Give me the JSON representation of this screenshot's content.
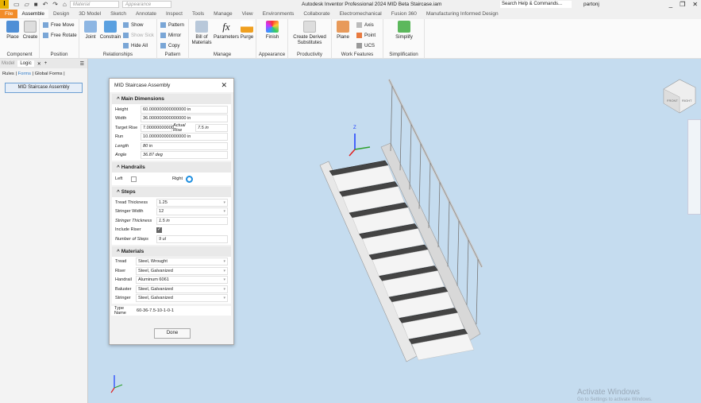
{
  "titlebar": {
    "app_title": "Autodesk Inventor Professional 2024   MID Beta Staircase.iam",
    "material_placeholder": "Material",
    "appearance_placeholder": "Appearance",
    "search_placeholder": "Search Help & Commands...",
    "user": "partonj"
  },
  "tabs": [
    "File",
    "Assemble",
    "Design",
    "3D Model",
    "Sketch",
    "Annotate",
    "Inspect",
    "Tools",
    "Manage",
    "View",
    "Environments",
    "Collaborate",
    "Electromechanical",
    "Fusion 360",
    "Manufacturing Informed Design"
  ],
  "active_tab": "Assemble",
  "ribbon": {
    "component": {
      "label": "Component",
      "place": "Place",
      "create": "Create"
    },
    "position": {
      "label": "Position",
      "free_move": "Free Move",
      "free_rotate": "Free Rotate"
    },
    "relationships": {
      "label": "Relationships",
      "joint": "Joint",
      "constrain": "Constrain",
      "show": "Show",
      "show_sick": "Show Sick",
      "hide_all": "Hide All"
    },
    "pattern": {
      "label": "Pattern",
      "pattern": "Pattern",
      "mirror": "Mirror",
      "copy": "Copy"
    },
    "manage": {
      "label": "Manage",
      "bom": "Bill of Materials",
      "parameters": "Parameters",
      "purge": "Purge"
    },
    "appearance": {
      "label": "Appearance",
      "finish": "Finish"
    },
    "productivity": {
      "label": "Productivity",
      "derived": "Create Derived Substitutes"
    },
    "work_features": {
      "label": "Work Features",
      "plane": "Plane",
      "axis": "Axis",
      "point": "Point",
      "ucs": "UCS"
    },
    "simplification": {
      "label": "Simplification",
      "simplify": "Simplify"
    }
  },
  "browser": {
    "tabs": [
      "Model",
      "Logic"
    ],
    "links": [
      "Rules",
      "Forms",
      "Global Forms"
    ],
    "selected_link": "Forms",
    "form_button": "MID Staircase Assembly"
  },
  "dialog": {
    "title": "MID Staircase Assembly",
    "main": {
      "header": "Main Dimensions",
      "height_label": "Height",
      "height": "60.000000000000000 in",
      "width_label": "Width",
      "width": "36.000000000000000 in",
      "target_rise_label": "Target Rise",
      "target_rise": "7.00000000000",
      "actual_rise_label": "Actual Rise",
      "actual_rise": "7.5 in",
      "run_label": "Run",
      "run": "10.000000000000000 in",
      "length_label": "Length",
      "length": "80 in",
      "angle_label": "Angle",
      "angle": "36.87 deg"
    },
    "handrails": {
      "header": "Handrails",
      "left_label": "Left",
      "left_checked": false,
      "right_label": "Right",
      "right_checked": true
    },
    "steps": {
      "header": "Steps",
      "tread_thickness_label": "Tread Thickness",
      "tread_thickness": "1.25",
      "stringer_width_label": "Stringer Width",
      "stringer_width": "12",
      "stringer_thickness_label": "Stringer Thickness",
      "stringer_thickness": "1.5 in",
      "include_riser_label": "Include Riser",
      "include_riser": true,
      "num_steps_label": "Number of Steps",
      "num_steps": "9 ul"
    },
    "materials": {
      "header": "Materials",
      "tread_label": "Tread",
      "tread": "Steel, Wrought",
      "riser_label": "Riser",
      "riser": "Steel, Galvanized",
      "handrail_label": "Handrail",
      "handrail": "Aluminum 6061",
      "baluster_label": "Baluster",
      "baluster": "Steel, Galvanized",
      "stringer_label": "Stringer",
      "stringer": "Steel, Galvanized"
    },
    "type_name_label": "Type Name",
    "type_name": "60-36-7.5-10-1-0-1",
    "done": "Done"
  },
  "viewcube": {
    "left": "FRONT",
    "right": "RIGHT"
  },
  "watermark": {
    "title": "Activate Windows",
    "sub": "Go to Settings to activate Windows."
  },
  "colors": {
    "accent": "#f28c28",
    "viewport": "#c5dcef",
    "link": "#2b79c9"
  }
}
